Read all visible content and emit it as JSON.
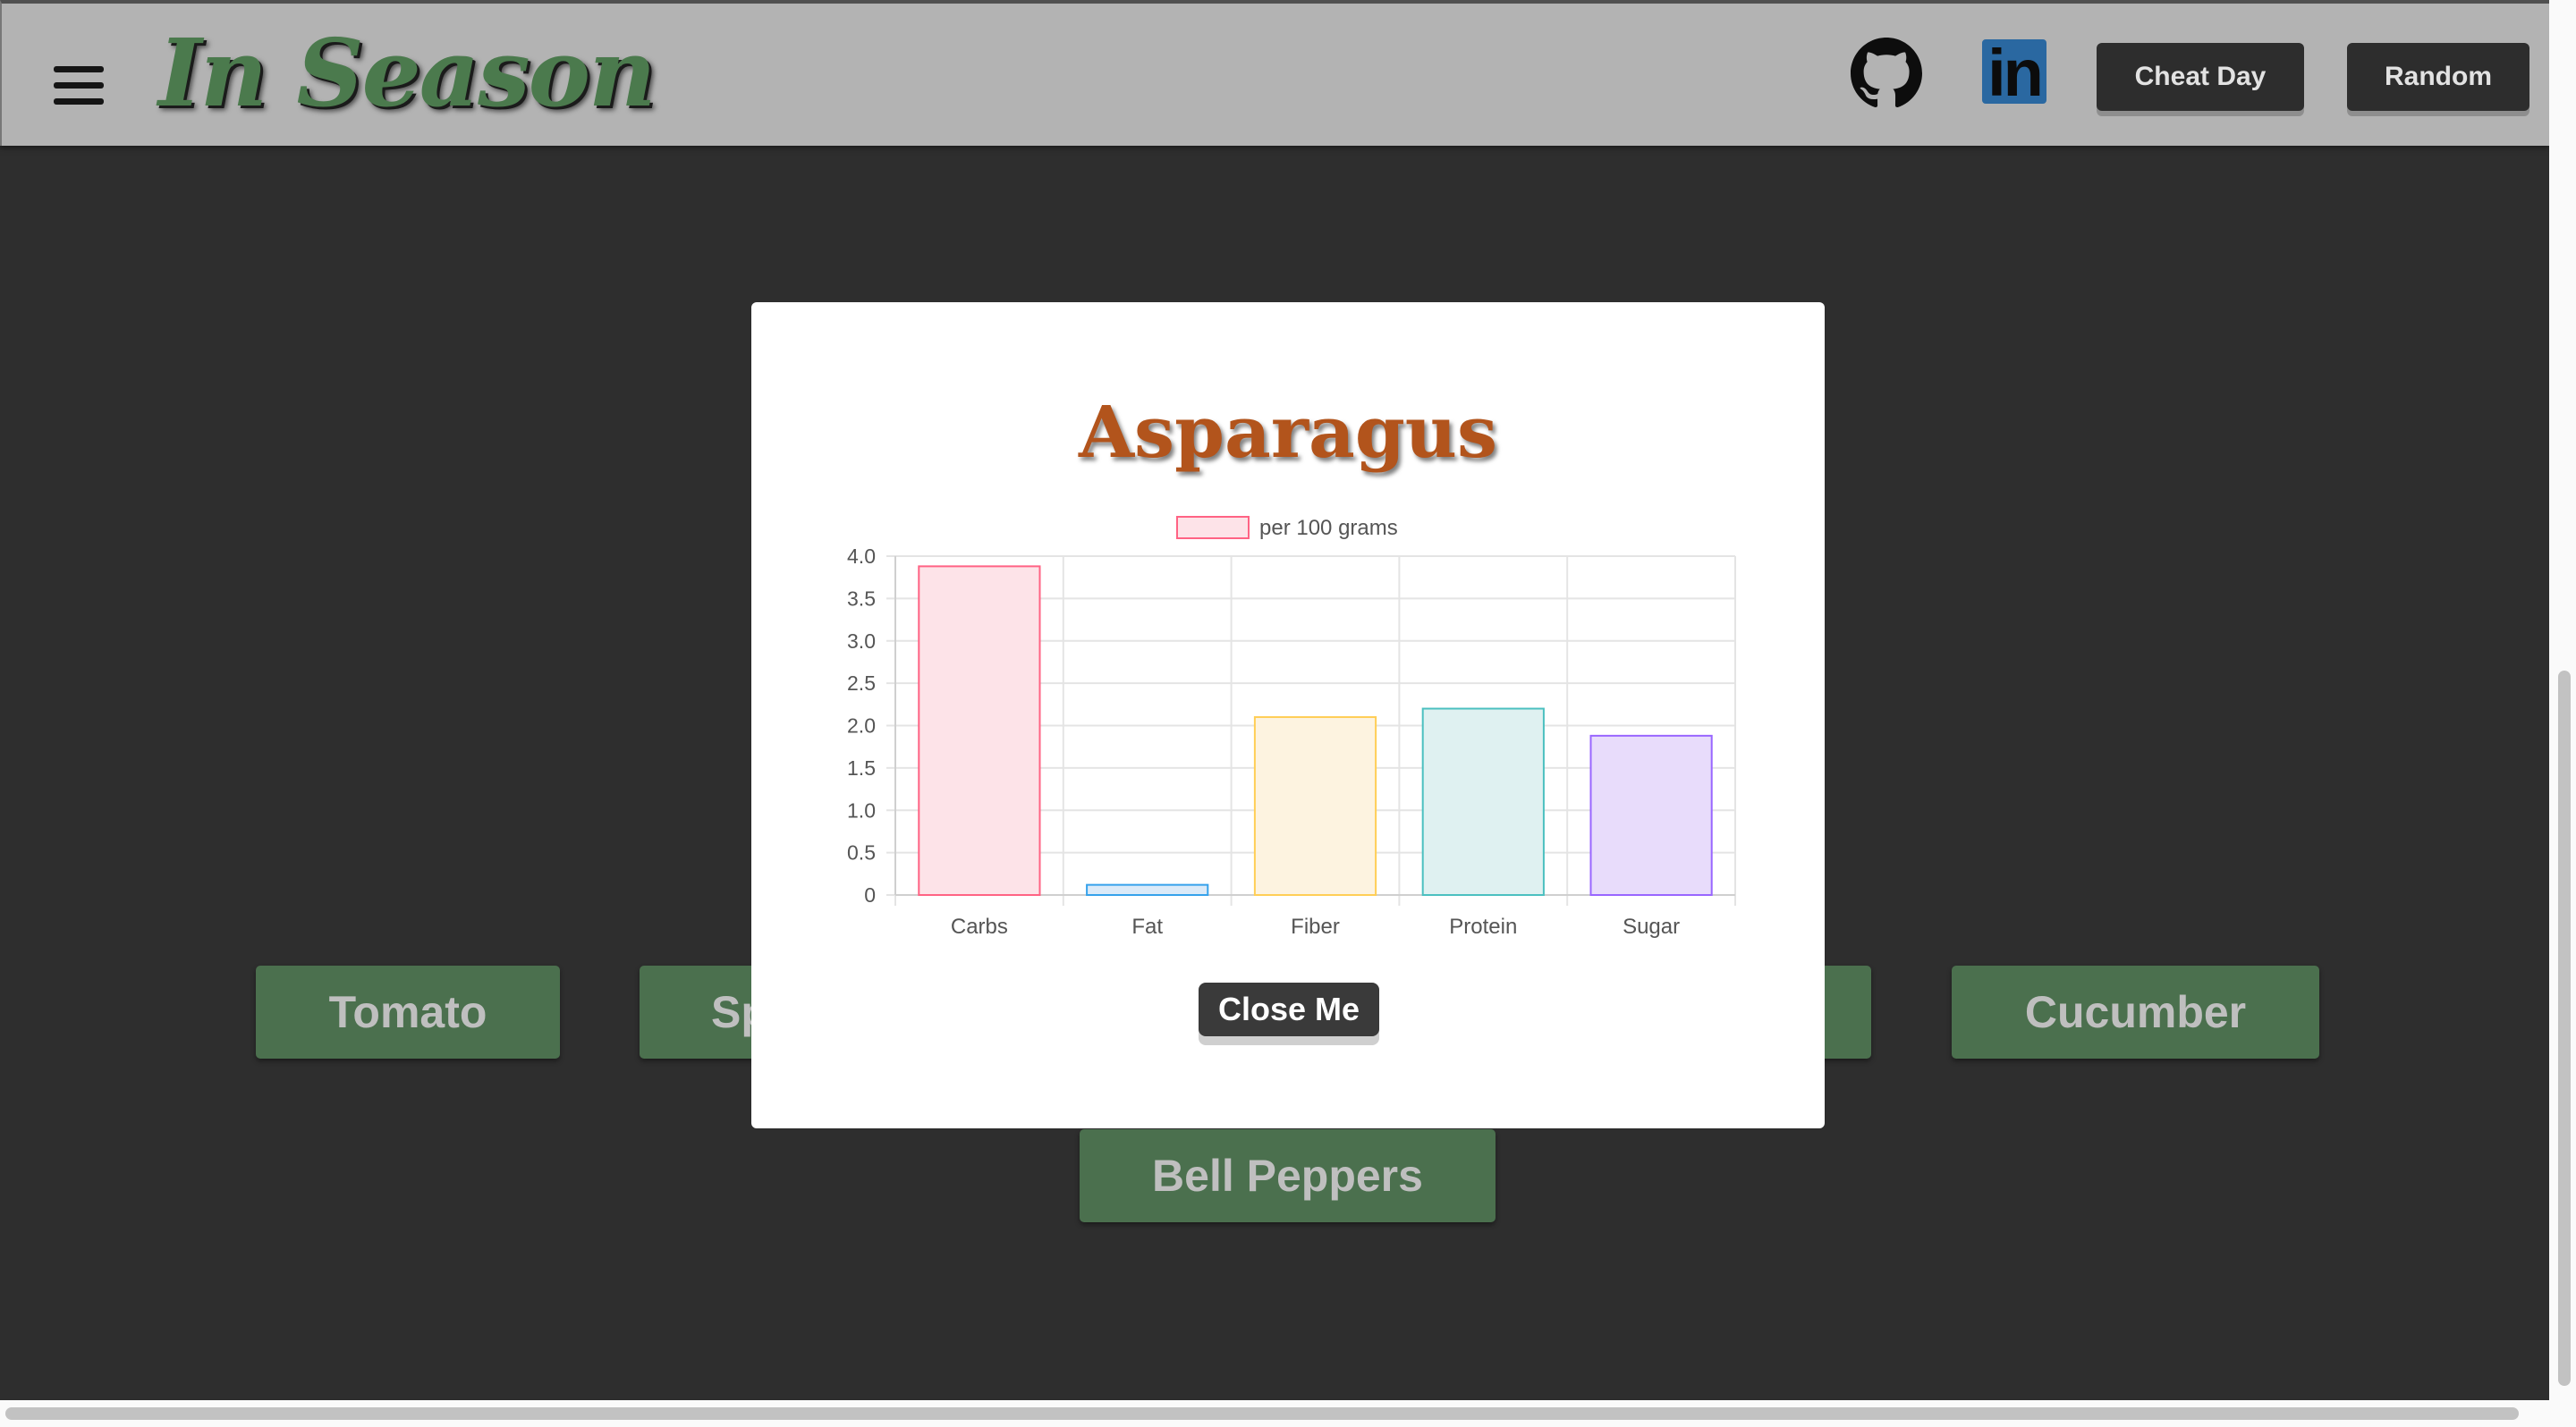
{
  "header": {
    "logo": "In Season",
    "menu_icon": "hamburger-icon",
    "github_icon": "github-icon",
    "linkedin_icon": "linkedin-icon",
    "linkedin_glyph": "in",
    "cheat_day_label": "Cheat Day",
    "random_label": "Random"
  },
  "produce": [
    {
      "label": "Tomato"
    },
    {
      "label": "Sp"
    },
    {
      "label": ""
    },
    {
      "label": "Cucumber"
    },
    {
      "label": "Bell Peppers"
    }
  ],
  "modal": {
    "title": "Asparagus",
    "close_label": "Close Me"
  },
  "chart_data": {
    "type": "bar",
    "categories": [
      "Carbs",
      "Fat",
      "Fiber",
      "Protein",
      "Sugar"
    ],
    "series": [
      {
        "name": "per 100 grams",
        "values": [
          3.88,
          0.12,
          2.1,
          2.2,
          1.88
        ]
      }
    ],
    "bar_fills": [
      "#fde3e8",
      "#dbeaf8",
      "#fdf3e0",
      "#dff1f1",
      "#e8dcfb"
    ],
    "bar_strokes": [
      "#ff6384",
      "#36a2eb",
      "#ffce56",
      "#4bc0c0",
      "#9966ff"
    ],
    "yticks": [
      "0",
      "0.5",
      "1.0",
      "1.5",
      "2.0",
      "2.5",
      "3.0",
      "3.5",
      "4.0"
    ],
    "ylim": [
      0,
      4
    ],
    "legend_position": "top",
    "grid": true
  },
  "colors": {
    "background": "#2e2e2e",
    "header": "#b3b3b3",
    "produce_button": "#4b704e",
    "title": "#b2541c"
  }
}
